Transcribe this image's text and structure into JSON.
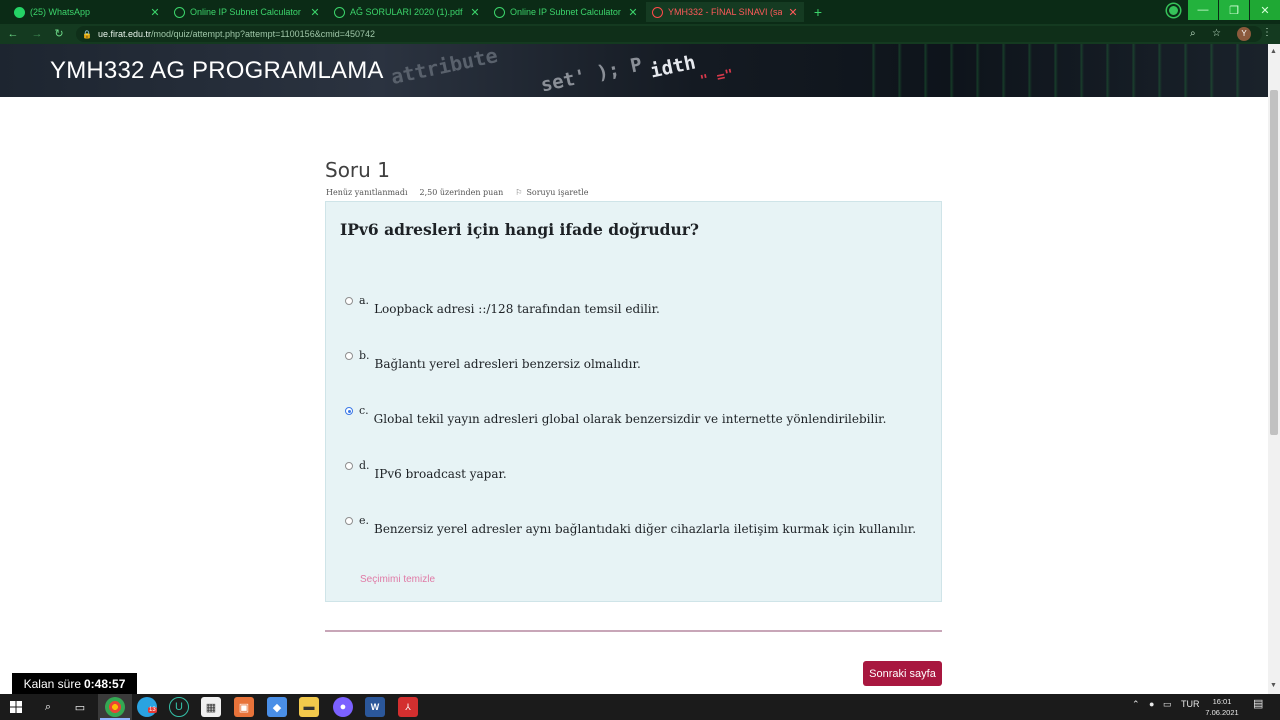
{
  "browser": {
    "tabs": [
      {
        "label": "(25) WhatsApp",
        "icon": "whatsapp-icon",
        "active": false
      },
      {
        "label": "Online IP Subnet Calculator",
        "icon": "globe-icon",
        "active": false
      },
      {
        "label": "AĞ SORULARI 2020 (1).pdf",
        "icon": "pdf-icon",
        "active": false
      },
      {
        "label": "Online IP Subnet Calculator",
        "icon": "globe-icon",
        "active": false
      },
      {
        "label": "YMH332 - FİNAL SINAVI (sayfa 1",
        "icon": "moodle-icon",
        "active": true
      }
    ],
    "new_tab": "+",
    "url_domain": "ue.firat.edu.tr",
    "url_path": "/mod/quiz/attempt.php?attempt=1100156&cmid=450742",
    "avatar_letter": "Y"
  },
  "header": {
    "site_title": "YMH332 AG PROGRAMLAMA",
    "deco_code": [
      "attribute",
      "set' ); P",
      "idth",
      "\" =\""
    ]
  },
  "question": {
    "title": "Soru 1",
    "status": "Henüz yanıtlanmadı",
    "points": "2,50 üzerinden puan",
    "flag_label": "Soruyu işaretle",
    "text": "IPv6 adresleri için hangi ifade doğrudur?",
    "options": [
      {
        "letter": "a.",
        "text": "Loopback adresi ::/128 tarafından temsil edilir.",
        "selected": false
      },
      {
        "letter": "b.",
        "text": " Bağlantı yerel adresleri benzersiz olmalıdır.",
        "selected": false
      },
      {
        "letter": "c.",
        "text": "Global tekil yayın adresleri global olarak benzersizdir ve internette yönlendirilebilir.",
        "selected": true
      },
      {
        "letter": "d.",
        "text": "IPv6 broadcast yapar.",
        "selected": false
      },
      {
        "letter": "e.",
        "text": " Benzersiz yerel adresler aynı bağlantıdaki diğer cihazlarla iletişim kurmak için kullanılır.",
        "selected": false
      }
    ],
    "clear_choice": "Seçimimi temizle"
  },
  "navigation": {
    "next_page": "Sonraki sayfa"
  },
  "timer": {
    "label": "Kalan süre",
    "value": "0:48:57"
  },
  "taskbar": {
    "language": "TUR",
    "time": "16:01",
    "date": "7.06.2021",
    "badge": "13"
  },
  "colors": {
    "accent": "#a8173f",
    "question_bg": "#e7f3f5",
    "clear_link": "#e07aa6"
  }
}
